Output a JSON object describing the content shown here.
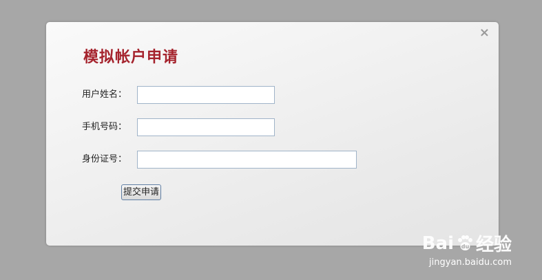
{
  "dialog": {
    "title": "模拟帐户申请",
    "close_symbol": "×",
    "fields": [
      {
        "label": "用户姓名：",
        "value": ""
      },
      {
        "label": "手机号码：",
        "value": ""
      },
      {
        "label": "身份证号：",
        "value": ""
      }
    ],
    "submit_label": "提交申请"
  },
  "watermark": {
    "brand": "Bai",
    "brand_suffix": "经验",
    "url": "jingyan.baidu.com"
  },
  "colors": {
    "background": "#a7a7a7",
    "title": "#a5232d",
    "input_border": "#9fb3c8"
  }
}
